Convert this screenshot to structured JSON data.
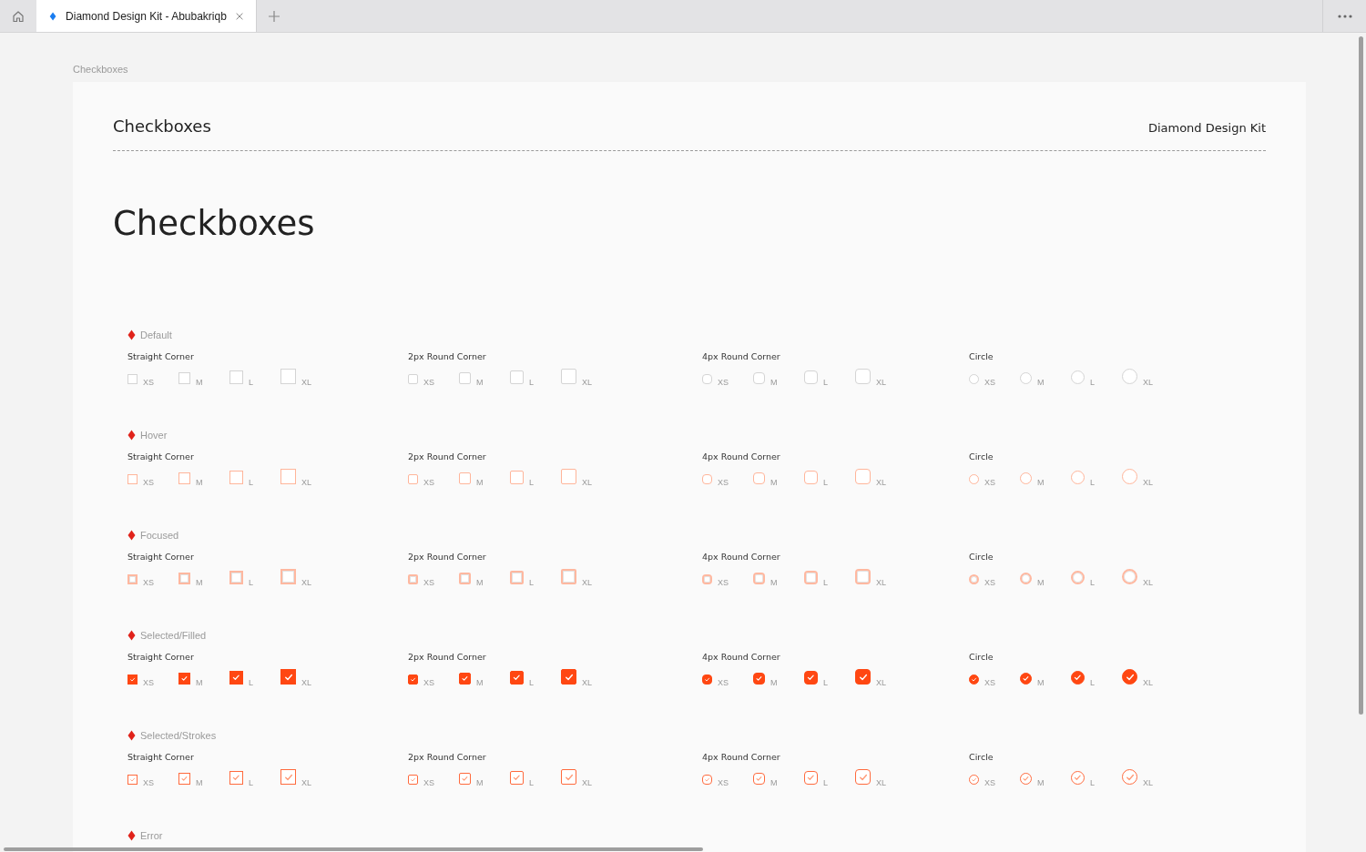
{
  "tab_bar": {
    "tabs": [
      {
        "title": "Diamond Design Kit - Abubakriqb",
        "selected": true
      }
    ]
  },
  "breadcrumb": "Checkboxes",
  "header": {
    "title": "Checkboxes",
    "brand": "Diamond Design Kit"
  },
  "page_title": "Checkboxes",
  "sections": [
    {
      "label": "Default",
      "kind": "default",
      "checked": false,
      "groups": [
        {
          "label": "Straight Corner",
          "kind": "straight",
          "items": [
            {
              "label": "XS"
            },
            {
              "label": "M"
            },
            {
              "label": "L"
            },
            {
              "label": "XL"
            }
          ]
        },
        {
          "label": "2px Round Corner",
          "kind": "r2",
          "items": [
            {
              "label": "XS"
            },
            {
              "label": "M"
            },
            {
              "label": "L"
            },
            {
              "label": "XL"
            }
          ]
        },
        {
          "label": "4px Round Corner",
          "kind": "r4",
          "items": [
            {
              "label": "XS"
            },
            {
              "label": "M"
            },
            {
              "label": "L"
            },
            {
              "label": "XL"
            }
          ]
        },
        {
          "label": "Circle",
          "kind": "circle",
          "items": [
            {
              "label": "XS"
            },
            {
              "label": "M"
            },
            {
              "label": "L"
            },
            {
              "label": "XL"
            }
          ]
        }
      ]
    },
    {
      "label": "Hover",
      "kind": "hover",
      "checked": false,
      "groups": [
        {
          "label": "Straight Corner",
          "kind": "straight",
          "items": [
            {
              "label": "XS"
            },
            {
              "label": "M"
            },
            {
              "label": "L"
            },
            {
              "label": "XL"
            }
          ]
        },
        {
          "label": "2px Round Corner",
          "kind": "r2",
          "items": [
            {
              "label": "XS"
            },
            {
              "label": "M"
            },
            {
              "label": "L"
            },
            {
              "label": "XL"
            }
          ]
        },
        {
          "label": "4px Round Corner",
          "kind": "r4",
          "items": [
            {
              "label": "XS"
            },
            {
              "label": "M"
            },
            {
              "label": "L"
            },
            {
              "label": "XL"
            }
          ]
        },
        {
          "label": "Circle",
          "kind": "circle",
          "items": [
            {
              "label": "XS"
            },
            {
              "label": "M"
            },
            {
              "label": "L"
            },
            {
              "label": "XL"
            }
          ]
        }
      ]
    },
    {
      "label": "Focused",
      "kind": "focused",
      "checked": false,
      "groups": [
        {
          "label": "Straight Corner",
          "kind": "straight",
          "items": [
            {
              "label": "XS"
            },
            {
              "label": "M"
            },
            {
              "label": "L"
            },
            {
              "label": "XL"
            }
          ]
        },
        {
          "label": "2px Round Corner",
          "kind": "r2",
          "items": [
            {
              "label": "XS"
            },
            {
              "label": "M"
            },
            {
              "label": "L"
            },
            {
              "label": "XL"
            }
          ]
        },
        {
          "label": "4px Round Corner",
          "kind": "r4",
          "items": [
            {
              "label": "XS"
            },
            {
              "label": "M"
            },
            {
              "label": "L"
            },
            {
              "label": "XL"
            }
          ]
        },
        {
          "label": "Circle",
          "kind": "circle",
          "items": [
            {
              "label": "XS"
            },
            {
              "label": "M"
            },
            {
              "label": "L"
            },
            {
              "label": "XL"
            }
          ]
        }
      ]
    },
    {
      "label": "Selected/Filled",
      "kind": "filled",
      "checked": true,
      "groups": [
        {
          "label": "Straight Corner",
          "kind": "straight",
          "items": [
            {
              "label": "XS"
            },
            {
              "label": "M"
            },
            {
              "label": "L"
            },
            {
              "label": "XL"
            }
          ]
        },
        {
          "label": "2px Round Corner",
          "kind": "r2",
          "items": [
            {
              "label": "XS"
            },
            {
              "label": "M"
            },
            {
              "label": "L"
            },
            {
              "label": "XL"
            }
          ]
        },
        {
          "label": "4px Round Corner",
          "kind": "r4",
          "items": [
            {
              "label": "XS"
            },
            {
              "label": "M"
            },
            {
              "label": "L"
            },
            {
              "label": "XL"
            }
          ]
        },
        {
          "label": "Circle",
          "kind": "circle",
          "items": [
            {
              "label": "XS"
            },
            {
              "label": "M"
            },
            {
              "label": "L"
            },
            {
              "label": "XL"
            }
          ]
        }
      ]
    },
    {
      "label": "Selected/Strokes",
      "kind": "strokes",
      "checked": true,
      "groups": [
        {
          "label": "Straight Corner",
          "kind": "straight",
          "items": [
            {
              "label": "XS"
            },
            {
              "label": "M"
            },
            {
              "label": "L"
            },
            {
              "label": "XL"
            }
          ]
        },
        {
          "label": "2px Round Corner",
          "kind": "r2",
          "items": [
            {
              "label": "XS"
            },
            {
              "label": "M"
            },
            {
              "label": "L"
            },
            {
              "label": "XL"
            }
          ]
        },
        {
          "label": "4px Round Corner",
          "kind": "r4",
          "items": [
            {
              "label": "XS"
            },
            {
              "label": "M"
            },
            {
              "label": "L"
            },
            {
              "label": "XL"
            }
          ]
        },
        {
          "label": "Circle",
          "kind": "circle",
          "items": [
            {
              "label": "XS"
            },
            {
              "label": "M"
            },
            {
              "label": "L"
            },
            {
              "label": "XL"
            }
          ]
        }
      ]
    },
    {
      "label": "Error"
    }
  ]
}
